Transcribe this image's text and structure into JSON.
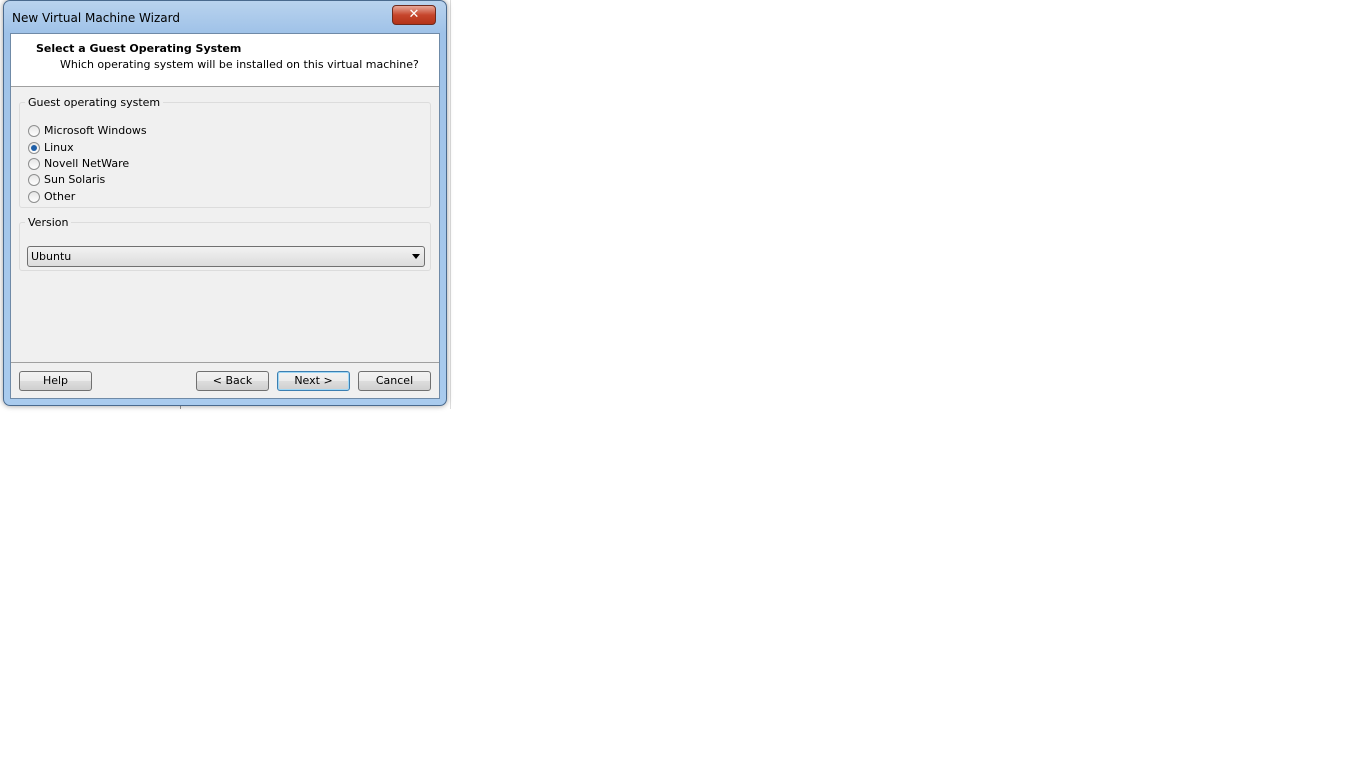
{
  "window": {
    "title": "New Virtual Machine Wizard",
    "close_label": "✕"
  },
  "header": {
    "title": "Select a Guest Operating System",
    "subtitle": "Which operating system will be installed on this virtual machine?"
  },
  "guest_os": {
    "legend": "Guest operating system",
    "options": [
      {
        "label": "Microsoft Windows",
        "selected": false
      },
      {
        "label": "Linux",
        "selected": true
      },
      {
        "label": "Novell NetWare",
        "selected": false
      },
      {
        "label": "Sun Solaris",
        "selected": false
      },
      {
        "label": "Other",
        "selected": false
      }
    ]
  },
  "version": {
    "legend": "Version",
    "selected": "Ubuntu"
  },
  "buttons": {
    "help": "Help",
    "back": "< Back",
    "next": "Next >",
    "cancel": "Cancel"
  }
}
